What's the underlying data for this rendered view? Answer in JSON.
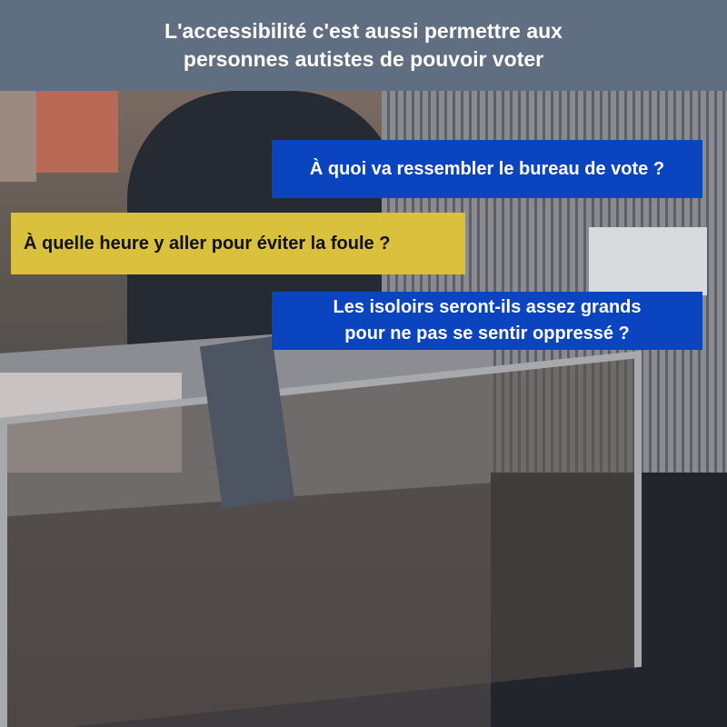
{
  "header": {
    "line1": "L'accessibilité c'est aussi permettre aux",
    "line2": "personnes autistes de pouvoir voter"
  },
  "questions": [
    {
      "lines": [
        "À quoi va ressembler le bureau de vote ?"
      ],
      "color": "#0b44bf"
    },
    {
      "lines": [
        "À quelle heure y aller pour éviter la foule ?"
      ],
      "color": "#d9c03d"
    },
    {
      "lines": [
        "Les isoloirs seront-ils assez grands",
        "pour ne pas se sentir oppressé ?"
      ],
      "color": "#0b44bf"
    }
  ]
}
